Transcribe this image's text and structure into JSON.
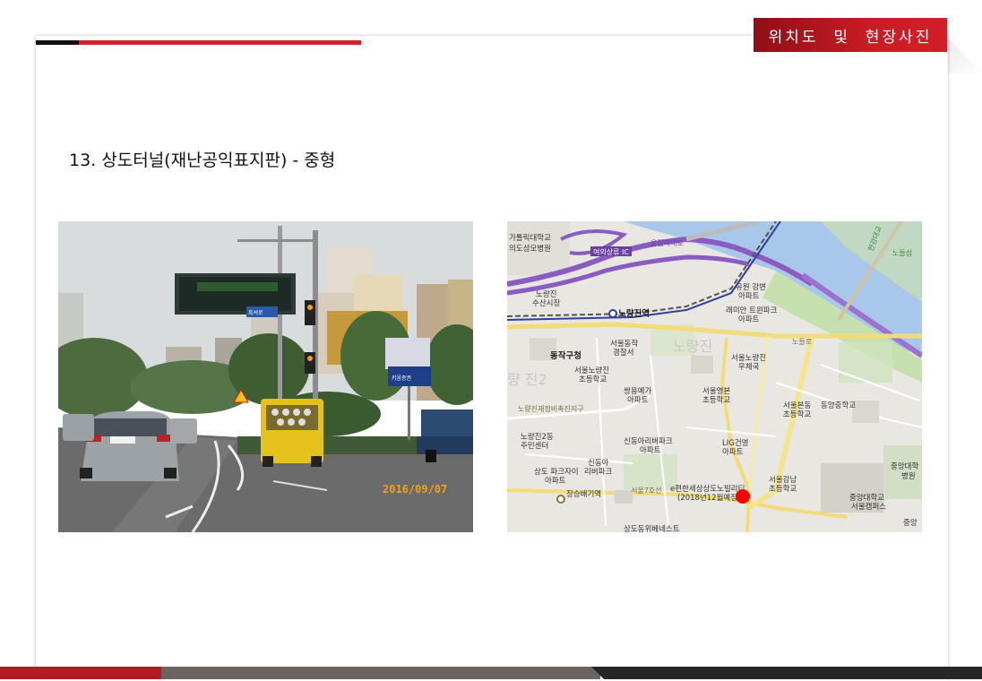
{
  "header": {
    "section_tab": "위치도  및  현장사진"
  },
  "slide": {
    "title": "13. 상도터널(재난공익표지판) - 중형"
  },
  "photo": {
    "timestamp": "2016/09/07",
    "street_sign": "흑석로",
    "sign_board": "키움증권"
  },
  "map": {
    "marker_color": "#ff0000",
    "labels": {
      "catholic_univ": "가톨릭대학교",
      "st_mary": "의도성모병원",
      "yeouido_ic": "여의상류 IC",
      "olympic_road": "올림픽대로",
      "noryangjin_market_a": "노량진",
      "noryangjin_market_b": "수산시장",
      "noryangjin_station": "노량진역",
      "yuwon_a": "유원 강변",
      "yuwon_b": "아파트",
      "lemian_a": "래미안 트윈파크",
      "lemian_b": "아파트",
      "dongjak_office": "동작구청",
      "seoul_police_a": "서울동작",
      "seoul_police_b": "경찰서",
      "noryangjin_post_a": "서울노량진",
      "noryangjin_post_b": "우체국",
      "noryangjin_elem_a": "서울노량진",
      "noryangjin_elem_b": "초등학교",
      "ssangyong_a": "쌍용예가",
      "ssangyong_b": "아파트",
      "yeongbon_a": "서울영본",
      "yeongbon_b": "초등학교",
      "bonDong_a": "서울본동",
      "bonDong_b": "초등학교",
      "dongyang_mid": "동양중학교",
      "renewal_zone": "노량진재정비촉진지구",
      "center_a": "노량진2동",
      "center_b": "주민센터",
      "sindong_a": "신동아리버파크",
      "sindong_b": "아파트",
      "lig_a": "LIG건영",
      "lig_b": "아파트",
      "sangdo_park_a": "상도 파크자이",
      "sangdo_park_b": "아파트",
      "sindong2_a": "신동아",
      "sindong2_b": "리버파크",
      "jangseungbaegi": "장승배기역",
      "pyeonhan_a": "e편한세상상도노빌리티",
      "pyeonhan_b": "(2018년12월예정)",
      "gangnam_elem_a": "서울강남",
      "gangnam_elem_b": "초등학교",
      "chungang_hosp_a": "중앙대학",
      "chungang_hosp_b": "병원",
      "chungang_univ_a": "중앙대학교",
      "chungang_univ_b": "서울캠퍼스",
      "sangdo_doongji": "상도동위베네스트",
      "nodeul_island": "노들섬",
      "hangang_bridge": "한강대교",
      "nodeul_road": "노들로",
      "faded_a": "노량진",
      "faded_b": "량 진2",
      "seoul7": "서울7호선",
      "jungang_small": "중앙"
    }
  }
}
